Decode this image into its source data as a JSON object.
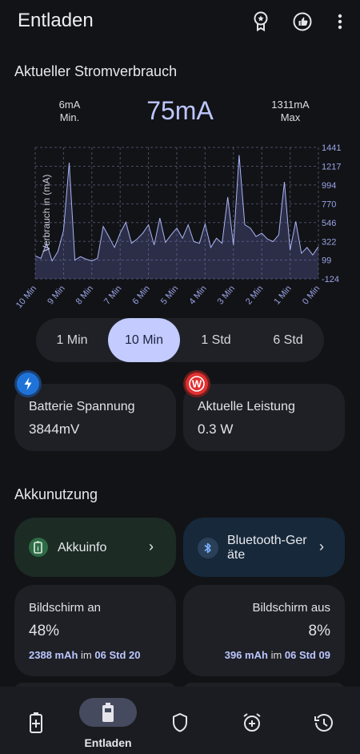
{
  "header": {
    "title": "Entladen",
    "icons": [
      "award-icon",
      "thumbs-up-icon",
      "more-vert-icon"
    ]
  },
  "current_usage": {
    "title": "Aktueller Stromverbrauch",
    "min_value": "6mA",
    "min_label": "Min.",
    "current": "75mA",
    "max_value": "1311mA",
    "max_label": "Max"
  },
  "chart_data": {
    "type": "line",
    "ylabel": "Verbrauch in (mA)",
    "x_ticks": [
      "10 Min",
      "9 Min",
      "8 Min",
      "7 Min",
      "6 Min",
      "5 Min",
      "4 Min",
      "3 Min",
      "2 Min",
      "1 Min",
      "0 Min"
    ],
    "y_ticks": [
      "1441",
      "1217",
      "994",
      "770",
      "546",
      "322",
      "99",
      "-124"
    ],
    "ylim": [
      -124,
      1441
    ],
    "xlim": [
      10,
      0
    ],
    "grid": true,
    "x": [
      10,
      9.8,
      9.6,
      9.4,
      9.2,
      9.0,
      8.8,
      8.6,
      8.4,
      8.2,
      8.0,
      7.8,
      7.6,
      7.4,
      7.2,
      7.0,
      6.8,
      6.6,
      6.4,
      6.2,
      6.0,
      5.8,
      5.6,
      5.4,
      5.2,
      5.0,
      4.8,
      4.6,
      4.4,
      4.2,
      4.0,
      3.8,
      3.6,
      3.4,
      3.2,
      3.0,
      2.8,
      2.6,
      2.4,
      2.2,
      2.0,
      1.8,
      1.6,
      1.4,
      1.2,
      1.0,
      0.8,
      0.6,
      0.4,
      0.2,
      0.0
    ],
    "values": [
      150,
      120,
      300,
      90,
      200,
      450,
      1260,
      100,
      140,
      110,
      90,
      120,
      500,
      380,
      250,
      420,
      550,
      300,
      350,
      420,
      520,
      280,
      600,
      310,
      400,
      480,
      360,
      520,
      320,
      300,
      530,
      250,
      360,
      300,
      850,
      280,
      1350,
      520,
      480,
      380,
      420,
      350,
      320,
      400,
      1030,
      220,
      560,
      180,
      250,
      160,
      260
    ]
  },
  "range_selector": {
    "options": [
      "1 Min",
      "10 Min",
      "1 Std",
      "6 Std"
    ],
    "selected": "10 Min"
  },
  "cards": {
    "voltage": {
      "label": "Batterie Spannung",
      "value": "3844mV",
      "icon": "bolt-icon",
      "color": "#1f73d8"
    },
    "power": {
      "label": "Aktuelle Leistung",
      "value": "0.3 W",
      "icon": "w-icon",
      "color": "#e03030"
    }
  },
  "akku": {
    "title": "Akkunutzung",
    "info_label": "Akkuinfo",
    "bluetooth_line1": "Bluetooth-Ger",
    "bluetooth_line2": "äte",
    "screen_on": {
      "label": "Bildschirm an",
      "percent": "48%",
      "mah": "2388 mAh",
      "im": "im",
      "duration": "06 Std 20"
    },
    "screen_off": {
      "label": "Bildschirm aus",
      "percent": "8%",
      "mah": "396 mAh",
      "im": "im",
      "duration": "06 Std 09"
    }
  },
  "nav": {
    "active_label": "Entladen",
    "items": [
      "battery-charge-icon",
      "battery-discharge-icon",
      "shield-icon",
      "alarm-add-icon",
      "history-icon"
    ]
  }
}
